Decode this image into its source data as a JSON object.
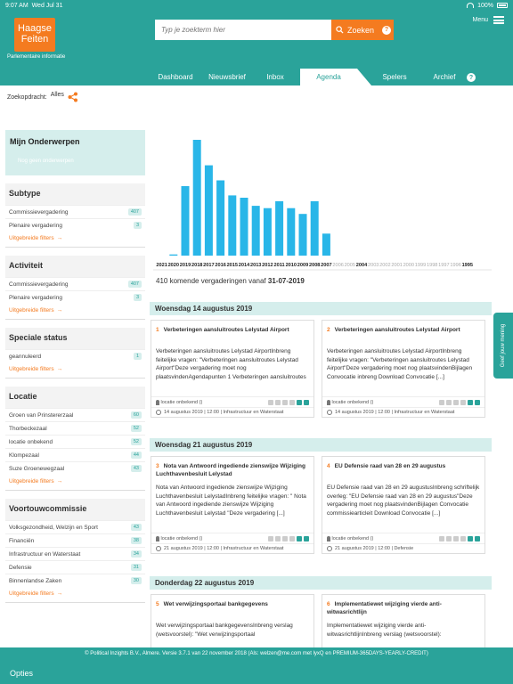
{
  "status": {
    "time": "9:07 AM",
    "date": "Wed Jul 31",
    "battery": "100%"
  },
  "logo": {
    "line1": "Haagse",
    "line2": "Feiten"
  },
  "tagline": "Parlementaire informatie",
  "search": {
    "placeholder": "Typ je zoekterm hier",
    "button": "Zoeken"
  },
  "menu": "Menu",
  "tabs": [
    {
      "label": "Dashboard"
    },
    {
      "label": "Nieuwsbrief"
    },
    {
      "label": "Inbox"
    },
    {
      "label": "Agenda"
    },
    {
      "label": "Spelers"
    },
    {
      "label": "Archief"
    }
  ],
  "zoek": {
    "label": "Zoekopdracht:",
    "value": "Alles"
  },
  "sidebar": {
    "my": {
      "title": "Mijn Onderwerpen",
      "sub": "Nog geen onderwerpen"
    },
    "sections": [
      {
        "title": "Subtype",
        "items": [
          {
            "label": "Commissievergadering",
            "count": "407"
          },
          {
            "label": "Plenaire vergadering",
            "count": "3"
          }
        ],
        "ext": "Uitgebreide filters"
      },
      {
        "title": "Activiteit",
        "items": [
          {
            "label": "Commissievergadering",
            "count": "407"
          },
          {
            "label": "Plenaire vergadering",
            "count": "3"
          }
        ],
        "ext": "Uitgebreide filters"
      },
      {
        "title": "Speciale status",
        "items": [
          {
            "label": "geannuleerd",
            "count": "1"
          }
        ],
        "ext": "Uitgebreide filters"
      },
      {
        "title": "Locatie",
        "items": [
          {
            "label": "Groen van Prinstererzaal",
            "count": "60"
          },
          {
            "label": "Thorbeckezaal",
            "count": "52"
          },
          {
            "label": "locatie onbekend",
            "count": "52"
          },
          {
            "label": "Klompezaal",
            "count": "44"
          },
          {
            "label": "Suze Groenewegzaal",
            "count": "43"
          }
        ],
        "ext": "Uitgebreide filters"
      },
      {
        "title": "Voortouwcommissie",
        "items": [
          {
            "label": "Volksgezondheid, Welzijn en Sport",
            "count": "43"
          },
          {
            "label": "Financiën",
            "count": "38"
          },
          {
            "label": "Infrastructuur en Waterstaat",
            "count": "34"
          },
          {
            "label": "Defensie",
            "count": "31"
          },
          {
            "label": "Binnenlandse Zaken",
            "count": "30"
          }
        ],
        "ext": "Uitgebreide filters"
      }
    ]
  },
  "chart_data": {
    "type": "bar",
    "categories": [
      "2021",
      "2020",
      "2019",
      "2018",
      "2017",
      "2016",
      "2015",
      "2014",
      "2013",
      "2012",
      "2011",
      "2010",
      "2009",
      "2008",
      "2007",
      "2006",
      "2005",
      "2004",
      "2003",
      "2002",
      "2001",
      "2000",
      "1999",
      "1998",
      "1997",
      "1996",
      "1995"
    ],
    "values": [
      0,
      1,
      60,
      100,
      78,
      65,
      52,
      50,
      43,
      41,
      47,
      41,
      36,
      47,
      19,
      0,
      0,
      0,
      0,
      0,
      0,
      0,
      0,
      0,
      0,
      0,
      0
    ],
    "bold_labels": [
      "2021",
      "2020",
      "2019",
      "2018",
      "2017",
      "2016",
      "2015",
      "2014",
      "2013",
      "2012",
      "2011",
      "2010",
      "2009",
      "2008",
      "2007",
      "2004",
      "1995"
    ],
    "color": "#29b6e8"
  },
  "count": {
    "prefix": "410 komende vergaderingen vanaf",
    "date": "31-07-2019"
  },
  "days": [
    {
      "header": "Woensdag 14 augustus 2019",
      "cards": [
        {
          "num": "1",
          "title": "Verbeteringen aansluitroutes Lelystad Airport",
          "body": "Verbeteringen aansluitroutes Lelystad AirportInbreng feitelijke vragen: \"Verbeteringen aansluitroutes Lelystad Airport\"Deze vergadering moet nog plaatsvindenAgendapunten 1 Verbeteringen aansluitroutes",
          "loc": "locatie onbekend ()",
          "date": "14 augustus 2019 | 12:00 | Infrastructuur en Waterstaat"
        },
        {
          "num": "2",
          "title": "Verbeteringen aansluitroutes Lelystad Airport",
          "body": "Verbeteringen aansluitroutes Lelystad AirportInbreng feitelijke vragen: \"Verbeteringen aansluitroutes Lelystad Airport\"Deze vergadering moet nog plaatsvindenBijlagen Convocatie inbreng Download Convocatie [...]",
          "loc": "locatie onbekend ()",
          "date": "14 augustus 2019 | 12:00 | Infrastructuur en Waterstaat"
        }
      ]
    },
    {
      "header": "Woensdag 21 augustus 2019",
      "cards": [
        {
          "num": "3",
          "title": "Nota van Antwoord ingediende zienswijze Wijziging Luchthavenbesluit Lelystad",
          "body": "Nota van Antwoord ingediende zienswijze Wijziging Luchthavenbesluit LelystadInbreng feitelijke vragen: \" Nota van Antwoord ingediende zienswijze Wijziging Luchthavenbesluit Lelystad \"Deze vergadering [...]",
          "loc": "locatie onbekend ()",
          "date": "21 augustus 2019 | 12:00 | Infrastructuur en Waterstaat"
        },
        {
          "num": "4",
          "title": "EU Defensie raad van 28 en 29 augustus",
          "body": "EU Defensie raad van 28 en 29 augustusInbreng schriftelijk overleg: \"EU Defensie raad van 28 en 29 augustus\"Deze vergadering moet nog plaatsvindenBijlagen Convocatie commissiearticleit Download Convocatie [...]",
          "loc": "locatie onbekend ()",
          "date": "21 augustus 2019 | 12:00 | Defensie"
        }
      ]
    },
    {
      "header": "Donderdag 22 augustus 2019",
      "cards": [
        {
          "num": "5",
          "title": "Wet verwijzingsportaal bankgegevens",
          "body": "Wet verwijzingsportaal bankgegevensInbreng verslag (wetsvoorstel): \"Wet verwijzingsportaal",
          "loc": "",
          "date": ""
        },
        {
          "num": "6",
          "title": "Implementatiewet wijziging vierde anti-witwasrichtlijn",
          "body": "Implementatiewet wijziging vierde anti-witwasrichtlijnInbreng verslag (wetsvoorstel):",
          "loc": "",
          "date": ""
        }
      ]
    }
  ],
  "feedback": "Geef jouw mening",
  "footer": "© Political Inzights B.V., Almere. Versie 3.7.1 van 22 november 2018 (Als: welzen@me.com met lyxQ en PREMIUM-365DAYS-YEARLY-CREDIT)",
  "opties": "Opties"
}
